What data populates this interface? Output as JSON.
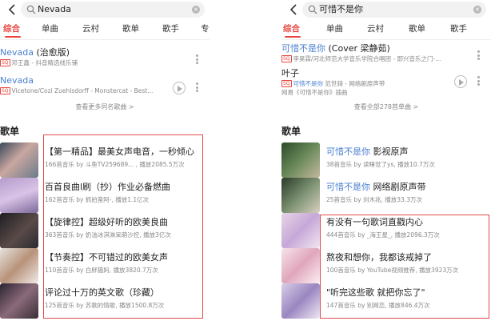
{
  "left": {
    "query": "Nevada",
    "clear_glyph": "×",
    "tabs": [
      "综合",
      "单曲",
      "云村",
      "歌单",
      "歌手",
      "专"
    ],
    "songs": [
      {
        "title_hl": "Nevada",
        "title_rest": " (治愈版)",
        "quality": "SQ",
        "meta_hl": "",
        "meta_rest": "邓王鑫 - 抖音精选线乐铺",
        "has_play": false
      },
      {
        "title_hl": "Nevada",
        "title_rest": "",
        "quality": "SQ",
        "meta_hl": "",
        "meta_rest": "Vicetone/Cozi Zuehlsdorff - Monstercat - Best...",
        "has_play": true
      }
    ],
    "more_songs": "查看更多同名歌曲 >",
    "section_title": "歌单",
    "playlists": [
      {
        "title_hl": "",
        "title_rest": "【第一精品】最美女声电音，一秒倾心",
        "meta": "166首音乐  by 斗鱼TV259689...  , 播放2085.5万次",
        "cover": "c1"
      },
      {
        "title_hl": "",
        "title_rest": "百首良曲l刷（抄）作业必备燃曲",
        "meta": "162首音乐  by 抓拍蛮阿-, 播放1.1亿次",
        "cover": "c2"
      },
      {
        "title_hl": "",
        "title_rest": "【旋律控】超级好听的欧美良曲",
        "meta": "363首音乐  by 奶油冰淇淋呆萌沙控, 播放3亿次",
        "cover": "c3"
      },
      {
        "title_hl": "",
        "title_rest": "【节奏控】不可错过的欧美女声",
        "meta": "110首音乐  by 白胖猫妈, 播放3820.7万次",
        "cover": "c4"
      },
      {
        "title_hl": "",
        "title_rest": "评论过十万的英文歌（珍藏）",
        "meta": "125首音乐  by 苏歌的情歌, 播放1500.8万次",
        "cover": "c5"
      }
    ]
  },
  "right": {
    "query": "可惜不是你",
    "clear_glyph": "×",
    "tabs": [
      "综合",
      "单曲",
      "云村",
      "歌单",
      "歌手"
    ],
    "songs": [
      {
        "title_hl": "可惜不是你",
        "title_rest": " (Cover 梁静茹)",
        "quality": "SQ",
        "meta_hl": "",
        "meta_rest": "李昊霖/河北师范大学音乐学院合唱团 - 即兴音乐之门-...",
        "has_play": false
      },
      {
        "title_hl": "",
        "title_rest": "叶子",
        "quality": "SQ",
        "meta_hl": "可惜不是你",
        "meta_rest": "范世錡 - 网络剧原声带",
        "has_play": true
      }
    ],
    "song2_extra": "网易《可惜不是你》插曲",
    "more_songs": "查看全部278首单曲 >",
    "section_title": "歌单",
    "playlists": [
      {
        "title_hl": "可惜不是你",
        "title_rest": " 影视原声",
        "meta": "38首音乐  by 读睡觉了ys, 播放10.7万次",
        "cover": "r1"
      },
      {
        "title_hl": "可惜不是你",
        "title_rest": " 网络剧原声带",
        "meta": "25首音乐  by 刘木兆, 播放33.3万次",
        "cover": "r2"
      },
      {
        "title_hl": "",
        "title_rest": "有没有一句歌词直戳内心",
        "meta": "444首音乐  by _海王星_, 播放2096.3万次",
        "cover": "r3"
      },
      {
        "title_hl": "",
        "title_rest": "熬夜和想你，我都该戒掉了",
        "meta": "100首音乐  by YouTube视频推荐, 播放3923万次",
        "cover": "r4"
      },
      {
        "title_hl": "",
        "title_rest": "\"听完这些歌 就把你忘了\"",
        "meta": "147首音乐  by 别网恋, 播放846.4万次",
        "cover": "r5"
      }
    ]
  },
  "colors": {
    "accent": "#e8443e",
    "highlight": "#4a7fd0",
    "outline": "#e34a4a"
  },
  "icons": [
    "back-arrow-icon",
    "search-icon",
    "clear-icon",
    "kebab-icon",
    "play-circle-icon",
    "playlist-cover-icon"
  ]
}
